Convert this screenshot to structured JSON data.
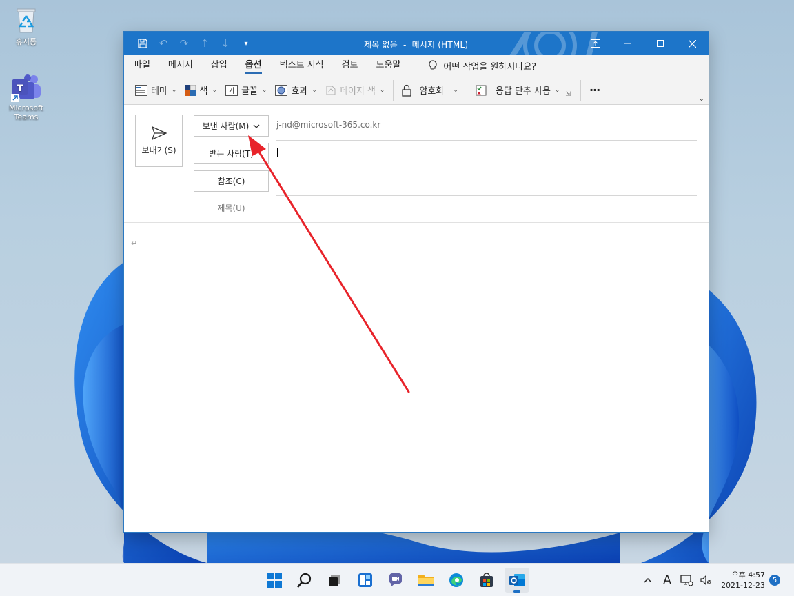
{
  "desktop": {
    "icons": [
      {
        "label": "휴지통",
        "icon": "recycle-bin-icon"
      },
      {
        "label": "Microsoft Teams",
        "icon": "teams-icon"
      }
    ]
  },
  "window": {
    "title": "제목 없음  -  메시지 (HTML)",
    "menu": [
      "파일",
      "메시지",
      "삽입",
      "옵션",
      "텍스트 서식",
      "검토",
      "도움말"
    ],
    "active_menu_index": 3,
    "tell_me": "어떤 작업을 원하시나요?",
    "ribbon": {
      "theme": "테마",
      "color": "색",
      "font": "글꼴",
      "effects": "효과",
      "page_color": "페이지 색",
      "encrypt": "암호화",
      "voting": "응답 단추 사용",
      "more": "···"
    },
    "compose": {
      "send": "보내기(S)",
      "from_button": "보낸 사람(M)",
      "from_value": "j-nd@microsoft-365.co.kr",
      "to_button": "받는 사람(T)",
      "cc_button": "참조(C)",
      "subject_label": "제목(U)",
      "paragraph_mark": "↵"
    }
  },
  "taskbar": {
    "apps": [
      "start-icon",
      "search-icon",
      "task-view-icon",
      "widgets-icon",
      "chat-icon",
      "file-explorer-icon",
      "edge-icon",
      "store-icon",
      "outlook-icon"
    ],
    "active_app": "outlook-icon",
    "tray": {
      "lang": "A",
      "time": "오후 4:57",
      "date": "2021-12-23",
      "notifications": "5"
    }
  },
  "colors": {
    "title_bar": "#1d75c9",
    "annotation_arrow": "#e8232a",
    "focus_line": "#2b6cb3"
  }
}
